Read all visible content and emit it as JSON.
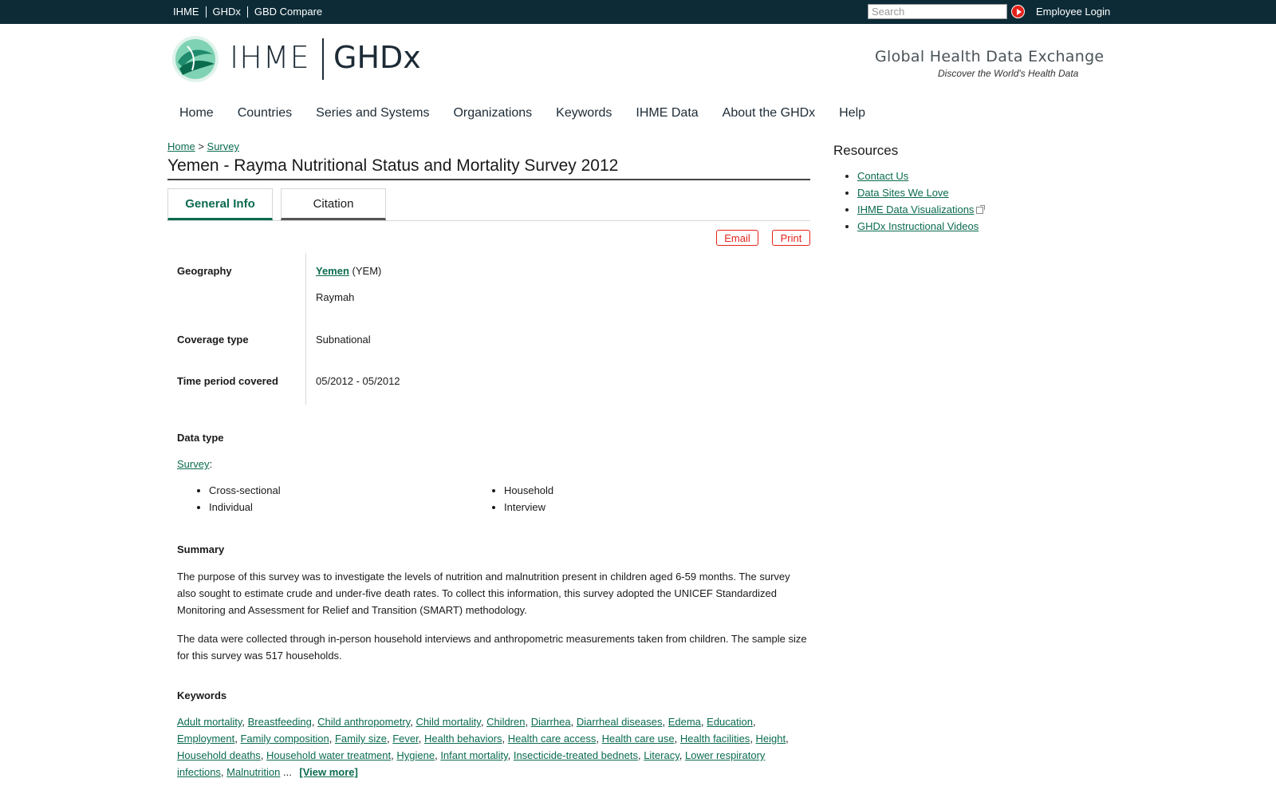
{
  "topbar": {
    "links": [
      "IHME",
      "GHDx",
      "GBD Compare"
    ],
    "search_placeholder": "Search",
    "employee_login": "Employee Login"
  },
  "header": {
    "logo_text_left": "IHME",
    "logo_text_right": "GHDx",
    "site_title": "Global Health Data Exchange",
    "site_slogan": "Discover the World's Health Data"
  },
  "nav": {
    "items": [
      "Home",
      "Countries",
      "Series and Systems",
      "Organizations",
      "Keywords",
      "IHME Data",
      "About the GHDx",
      "Help"
    ]
  },
  "breadcrumb": {
    "home": "Home",
    "separator": ">",
    "survey": "Survey"
  },
  "page": {
    "title": "Yemen - Rayma Nutritional Status and Mortality Survey 2012"
  },
  "tabs": {
    "general": "General Info",
    "citation": "Citation"
  },
  "actions": {
    "email": "Email",
    "print": "Print"
  },
  "fields": {
    "geography_label": "Geography",
    "geography_country": "Yemen",
    "geography_code": "(YEM)",
    "geography_region": "Raymah",
    "coverage_label": "Coverage type",
    "coverage_value": "Subnational",
    "time_label": "Time period covered",
    "time_value": "05/2012 - 05/2012"
  },
  "data_type": {
    "label": "Data type",
    "link": "Survey",
    "colon": ":",
    "col1": [
      "Cross-sectional",
      "Individual"
    ],
    "col2": [
      "Household",
      "Interview"
    ]
  },
  "summary": {
    "label": "Summary",
    "para1": "The purpose of this survey was to investigate the levels of nutrition and malnutrition present in children aged 6-59 months. The survey also sought to estimate crude and under-five death rates. To collect this information, this survey adopted the UNICEF Standardized Monitoring and Assessment for Relief and Transition (SMART) methodology.",
    "para2": "The data were collected through in-person household interviews and anthropometric measurements taken from children. The sample size for this survey was 517 households."
  },
  "keywords": {
    "label": "Keywords",
    "items": [
      "Adult mortality",
      "Breastfeeding",
      "Child anthropometry",
      "Child mortality",
      "Children",
      "Diarrhea",
      "Diarrheal diseases",
      "Edema",
      "Education",
      "Employment",
      "Family composition",
      "Family size",
      "Fever",
      "Health behaviors",
      "Health care access",
      "Health care use",
      "Health facilities",
      "Height",
      "Household deaths",
      "Household water treatment",
      "Hygiene",
      "Infant mortality",
      "Insecticide-treated bednets",
      "Literacy",
      "Lower respiratory infections",
      "Malnutrition"
    ],
    "ellipsis": "...",
    "view_more": "[View more]"
  },
  "sidebar": {
    "title": "Resources",
    "links": [
      "Contact Us",
      "Data Sites We Love",
      "IHME Data Visualizations",
      "GHDx Instructional Videos"
    ]
  },
  "colors": {
    "topbar": "#0c2b36",
    "link": "#0b6b4f",
    "accent_red": "#e4231b"
  }
}
